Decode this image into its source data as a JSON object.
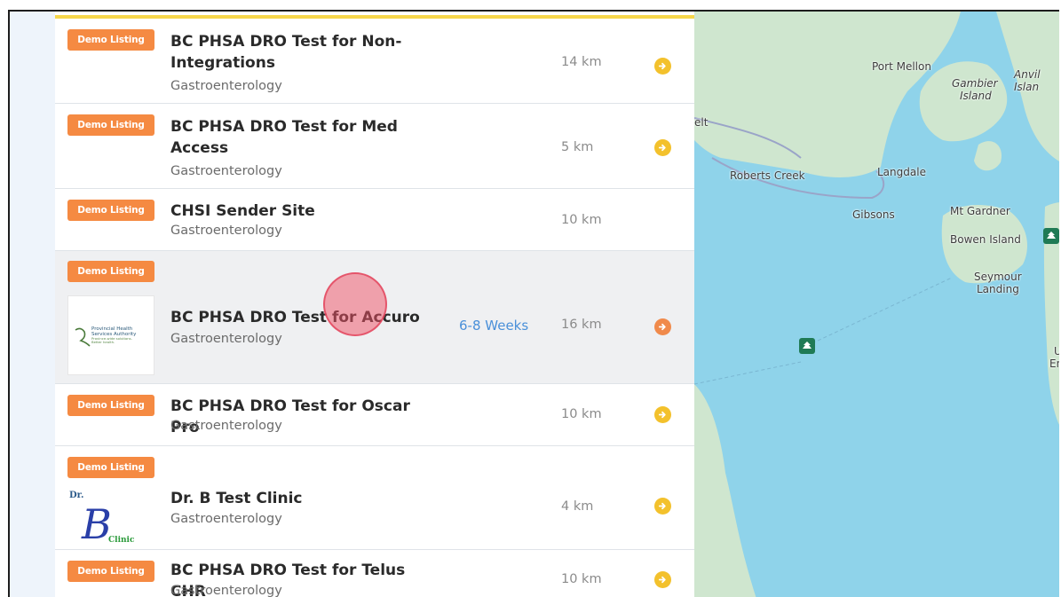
{
  "listings": [
    {
      "badge": "Demo Listing",
      "name": "BC PHSA DRO Test for Non-Integrations",
      "specialty": "Gastroenterology",
      "distance": "14 km"
    },
    {
      "badge": "Demo Listing",
      "name": "BC PHSA DRO Test for Med Access",
      "specialty": "Gastroenterology",
      "distance": "5 km"
    },
    {
      "badge": "Demo Listing",
      "name": "CHSI Sender Site",
      "specialty": "Gastroenterology",
      "distance": "10 km"
    },
    {
      "badge": "Demo Listing",
      "name": "BC PHSA DRO Test for Accuro",
      "specialty": "Gastroenterology",
      "distance": "16 km",
      "wait": "6-8 Weeks",
      "logo_text": [
        "Provincial Health",
        "Services Authority",
        "Province-wide solutions.",
        "Better health."
      ]
    },
    {
      "badge": "Demo Listing",
      "name": "BC PHSA DRO Test for Oscar Pro",
      "specialty": "Gastroenterology",
      "distance": "10 km"
    },
    {
      "badge": "Demo Listing",
      "name": "Dr. B Test Clinic",
      "specialty": "Gastroenterology",
      "distance": "4 km",
      "logo_text": [
        "Dr.",
        "B",
        "Clinic"
      ]
    },
    {
      "badge": "Demo Listing",
      "name": "BC PHSA DRO Test for Telus CHR",
      "specialty": "Gastroenterology",
      "distance": "10 km"
    }
  ],
  "map": {
    "labels": {
      "port_mellon": "Port Mellon",
      "gambier": "Gambier",
      "island": "Island",
      "anvil": "Anvil Islan",
      "elt": "elt",
      "roberts_creek": "Roberts Creek",
      "langdale": "Langdale",
      "gibsons": "Gibsons",
      "mt_gardner": "Mt Gardner",
      "bowen": "Bowen Island",
      "seymour": "Seymour",
      "landing": "Landing",
      "u": "U",
      "en": "En"
    }
  },
  "colors": {
    "badge": "#f58a42",
    "go_yellow": "#f3c12c",
    "go_orange": "#f08a4b",
    "wait_blue": "#4a90d9",
    "water": "#8fd3ea",
    "land": "#cfe6cf"
  }
}
